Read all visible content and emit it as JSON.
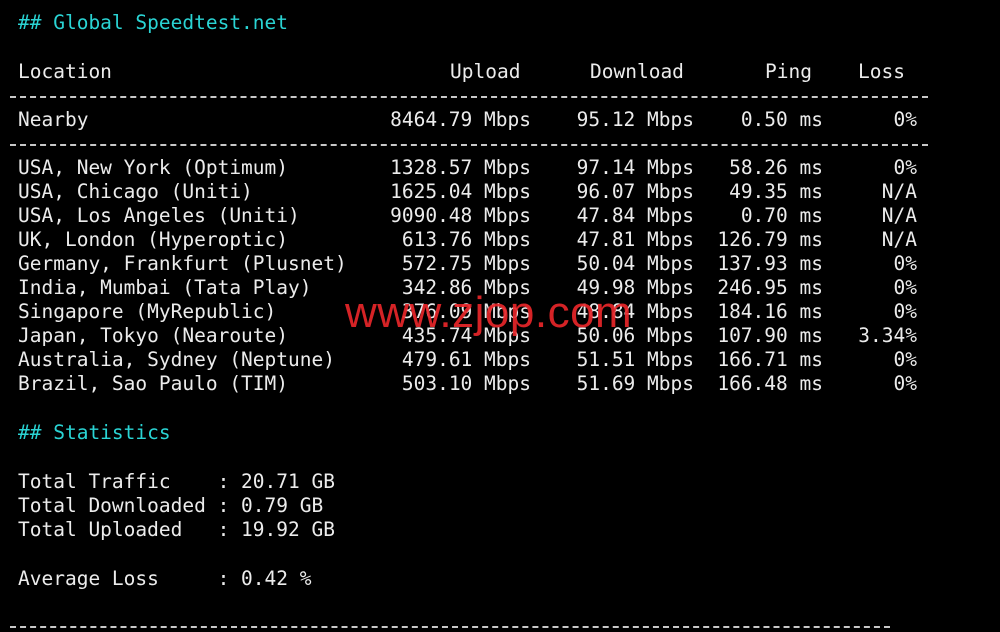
{
  "headings": {
    "speedtest": "## Global Speedtest.net",
    "statistics": "## Statistics"
  },
  "columns": {
    "location": "Location",
    "upload": "Upload",
    "download": "Download",
    "ping": "Ping",
    "loss": "Loss"
  },
  "nearby": {
    "location": "Nearby",
    "upload": "8464.79 Mbps",
    "download": "95.12 Mbps",
    "ping": "0.50 ms",
    "loss": "0%"
  },
  "rows": [
    {
      "location": "USA, New York (Optimum)",
      "upload": "1328.57 Mbps",
      "download": "97.14 Mbps",
      "ping": "58.26 ms",
      "loss": "0%"
    },
    {
      "location": "USA, Chicago (Uniti)",
      "upload": "1625.04 Mbps",
      "download": "96.07 Mbps",
      "ping": "49.35 ms",
      "loss": "N/A"
    },
    {
      "location": "USA, Los Angeles (Uniti)",
      "upload": "9090.48 Mbps",
      "download": "47.84 Mbps",
      "ping": "0.70 ms",
      "loss": "N/A"
    },
    {
      "location": "UK, London (Hyperoptic)",
      "upload": "613.76 Mbps",
      "download": "47.81 Mbps",
      "ping": "126.79 ms",
      "loss": "N/A"
    },
    {
      "location": "Germany, Frankfurt (Plusnet)",
      "upload": "572.75 Mbps",
      "download": "50.04 Mbps",
      "ping": "137.93 ms",
      "loss": "0%"
    },
    {
      "location": "India, Mumbai (Tata Play)",
      "upload": "342.86 Mbps",
      "download": "49.98 Mbps",
      "ping": "246.95 ms",
      "loss": "0%"
    },
    {
      "location": "Singapore (MyRepublic)",
      "upload": "376.09 Mbps",
      "download": "48.84 Mbps",
      "ping": "184.16 ms",
      "loss": "0%"
    },
    {
      "location": "Japan, Tokyo (Nearoute)",
      "upload": "435.74 Mbps",
      "download": "50.06 Mbps",
      "ping": "107.90 ms",
      "loss": "3.34%"
    },
    {
      "location": "Australia, Sydney (Neptune)",
      "upload": "479.61 Mbps",
      "download": "51.51 Mbps",
      "ping": "166.71 ms",
      "loss": "0%"
    },
    {
      "location": "Brazil, Sao Paulo (TIM)",
      "upload": "503.10 Mbps",
      "download": "51.69 Mbps",
      "ping": "166.48 ms",
      "loss": "0%"
    }
  ],
  "stats": {
    "total_traffic": "Total Traffic    : 20.71 GB",
    "total_downloaded": "Total Downloaded : 0.79 GB",
    "total_uploaded": "Total Uploaded   : 19.92 GB",
    "average_loss": "Average Loss     : 0.42 %"
  },
  "watermark": "www.zjop.com",
  "colors": {
    "background": "#000000",
    "text": "#ececec",
    "heading": "#2ad4d4",
    "watermark": "#e8262a"
  }
}
